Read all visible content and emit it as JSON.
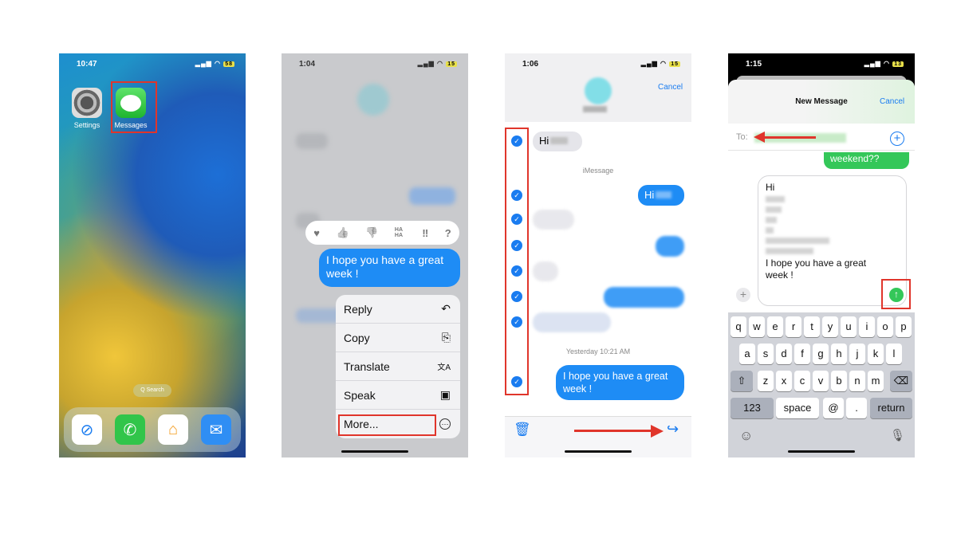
{
  "phone1": {
    "time": "10:47",
    "battery": "58",
    "apps": [
      {
        "label": "Settings",
        "icon": "settings-gear-icon"
      },
      {
        "label": "Messages",
        "icon": "messages-bubble-icon"
      }
    ],
    "search_label": "Q Search",
    "dock": [
      "safari-icon",
      "phone-icon",
      "home-icon",
      "mail-icon"
    ]
  },
  "phone2": {
    "time": "1:04",
    "battery": "15",
    "reactions": [
      "♥",
      "👍",
      "👎",
      "HA HA",
      "‼",
      "?"
    ],
    "message": "I hope you have a great week !",
    "menu": [
      {
        "label": "Reply",
        "icon": "↶"
      },
      {
        "label": "Copy",
        "icon": "⎘"
      },
      {
        "label": "Translate",
        "icon": "文A"
      },
      {
        "label": "Speak",
        "icon": "▣"
      },
      {
        "label": "More...",
        "icon": "⋯"
      }
    ]
  },
  "phone3": {
    "time": "1:06",
    "battery": "15",
    "cancel": "Cancel",
    "hi_incoming": "Hi",
    "service_label": "iMessage",
    "hi_outgoing": "Hi",
    "timestamp": "Yesterday 10:21 AM",
    "message": "I hope you have a great week !"
  },
  "phone4": {
    "time": "1:15",
    "battery": "13",
    "title": "New Message",
    "cancel": "Cancel",
    "to_label": "To:",
    "prev_bubble": "weekend??",
    "compose_first": "Hi",
    "compose_last": "I hope you have a great week !",
    "keyboard": {
      "row1": [
        "q",
        "w",
        "e",
        "r",
        "t",
        "y",
        "u",
        "i",
        "o",
        "p"
      ],
      "row2": [
        "a",
        "s",
        "d",
        "f",
        "g",
        "h",
        "j",
        "k",
        "l"
      ],
      "row3": [
        "z",
        "x",
        "c",
        "v",
        "b",
        "n",
        "m"
      ],
      "numbers": "123",
      "space": "space",
      "at": "@",
      "dot": ".",
      "return": "return"
    }
  },
  "colors": {
    "highlight": "#e0352b",
    "imessage_blue": "#1e8cf5",
    "sms_green": "#34c759"
  }
}
